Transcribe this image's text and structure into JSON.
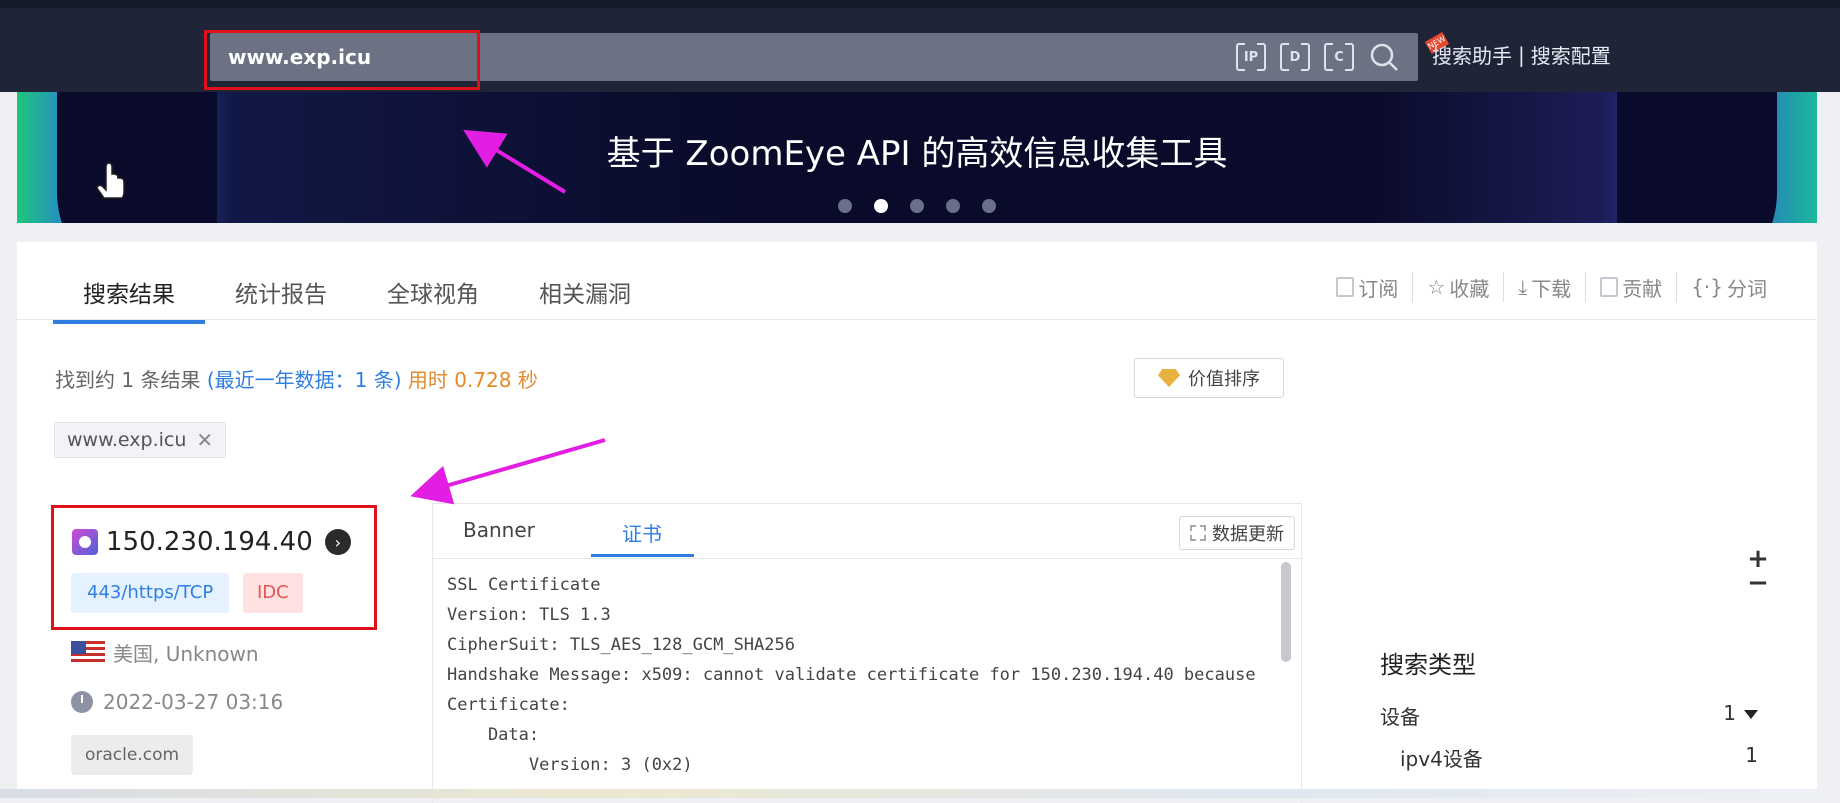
{
  "search": {
    "query": "www.exp.icu",
    "tools": [
      "IP",
      "D",
      "C"
    ],
    "links": [
      "搜索助手",
      "搜索配置"
    ],
    "new_badge": "NEW"
  },
  "banner": {
    "text": "基于 ZoomEye API 的高效信息收集工具",
    "dot_count": 5,
    "active_dot": 1
  },
  "tabs": [
    "搜索结果",
    "统计报告",
    "全球视角",
    "相关漏洞"
  ],
  "actions": [
    "订阅",
    "收藏",
    "下载",
    "贡献",
    "分词"
  ],
  "summary": {
    "found": "找到约 1 条结果",
    "recent": "(最近一年数据：1 条)",
    "time": "用时 0.728 秒"
  },
  "sort_label": "价值排序",
  "filter_chip": "www.exp.icu",
  "result": {
    "ip": "150.230.194.40",
    "port_tag": "443/https/TCP",
    "idc_tag": "IDC",
    "location": "美国, Unknown",
    "time": "2022-03-27 03:16",
    "domain": "oracle.com"
  },
  "detail": {
    "tabs": [
      "Banner",
      "证书"
    ],
    "update_label": "数据更新",
    "cert_lines": [
      "SSL Certificate",
      "Version: TLS 1.3",
      "CipherSuit: TLS_AES_128_GCM_SHA256",
      "Handshake Message: x509: cannot validate certificate for 150.230.194.40 because",
      "Certificate:",
      "    Data:",
      "        Version: 3 (0x2)"
    ]
  },
  "zoom": [
    "+",
    "−"
  ],
  "side_panel": {
    "title": "搜索类型",
    "rows": [
      {
        "label": "设备",
        "count": "1"
      },
      {
        "label": "ipv4设备",
        "count": "1"
      }
    ]
  },
  "colors": {
    "accent": "#2f7fe0",
    "annotation_box": "#e0101a",
    "annotation_arrow": "#e31ee3"
  }
}
